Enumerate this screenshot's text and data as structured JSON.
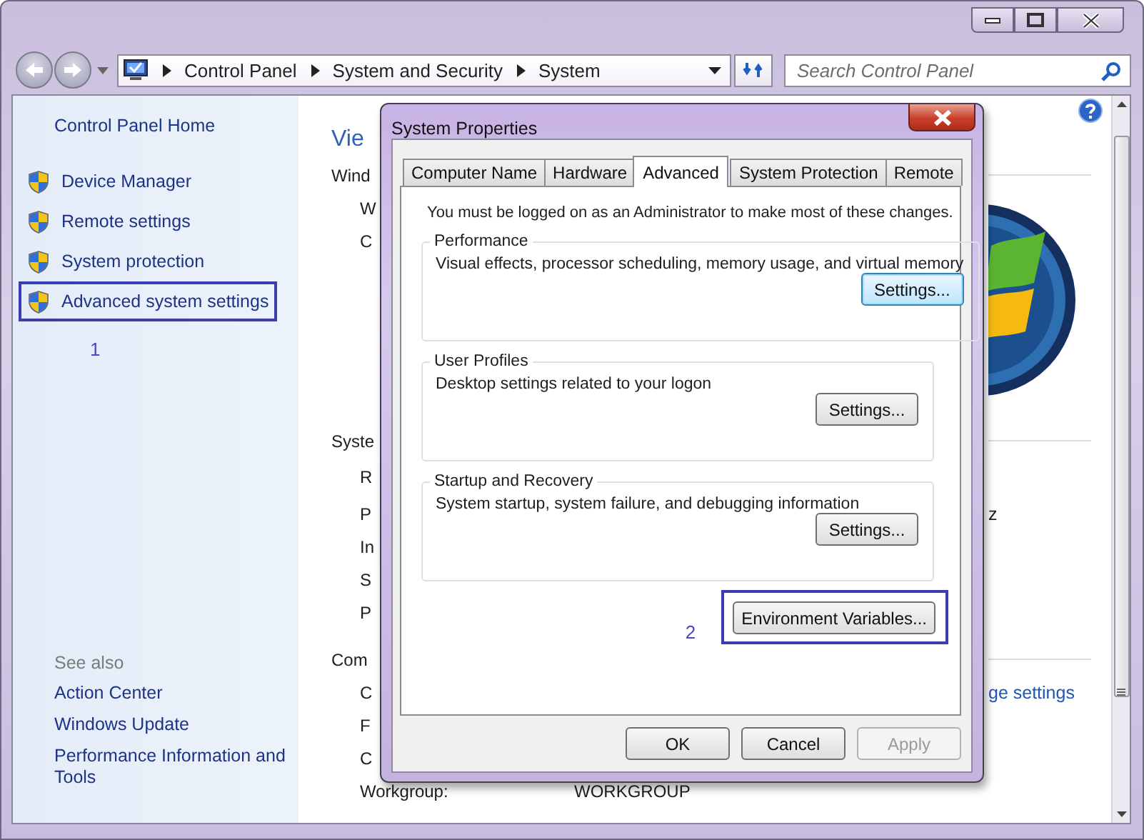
{
  "address_bar": {
    "crumbs": [
      "Control Panel",
      "System and Security",
      "System"
    ]
  },
  "search": {
    "placeholder": "Search Control Panel"
  },
  "sidebar": {
    "home": "Control Panel Home",
    "tasks": [
      {
        "label": "Device Manager",
        "highlighted": false
      },
      {
        "label": "Remote settings",
        "highlighted": false
      },
      {
        "label": "System protection",
        "highlighted": false
      },
      {
        "label": "Advanced system settings",
        "highlighted": true
      }
    ],
    "step_label": "1",
    "see_also": {
      "title": "See also",
      "links": [
        "Action Center",
        "Windows Update",
        "Performance Information and Tools"
      ]
    }
  },
  "content": {
    "title": "Vie",
    "sections": [
      {
        "heading": "Wind",
        "rows": [
          {
            "label": "W"
          },
          {
            "label": "C"
          }
        ]
      },
      {
        "heading": "Syste",
        "rows": [
          {
            "label": "R"
          },
          {
            "label": "P",
            "tail": {
              "text": "z",
              "kind": "text"
            }
          },
          {
            "label": "In"
          },
          {
            "label": "S"
          },
          {
            "label": "P"
          }
        ]
      },
      {
        "heading": "Com",
        "rows": [
          {
            "label": "C",
            "tail": {
              "text": "ge settings",
              "kind": "link"
            }
          },
          {
            "label": "F"
          },
          {
            "label": "C"
          },
          {
            "label": "Workgroup:",
            "value": "WORKGROUP"
          }
        ]
      }
    ]
  },
  "dialog": {
    "title": "System Properties",
    "tabs": [
      {
        "label": "Computer Name",
        "selected": false
      },
      {
        "label": "Hardware",
        "selected": false
      },
      {
        "label": "Advanced",
        "selected": true
      },
      {
        "label": "System Protection",
        "selected": false
      },
      {
        "label": "Remote",
        "selected": false
      }
    ],
    "notice": "You must be logged on as an Administrator to make most of these changes.",
    "groups": [
      {
        "legend": "Performance",
        "description": "Visual effects, processor scheduling, memory usage, and virtual memory",
        "button": {
          "label": "Settings...",
          "default": true
        }
      },
      {
        "legend": "User Profiles",
        "description": "Desktop settings related to your logon",
        "button": {
          "label": "Settings...",
          "default": false
        }
      },
      {
        "legend": "Startup and Recovery",
        "description": "System startup, system failure, and debugging information",
        "button": {
          "label": "Settings...",
          "default": false
        }
      }
    ],
    "step_label": "2",
    "env_button": {
      "label": "Environment Variables...",
      "highlighted": true
    },
    "buttons": [
      {
        "label": "OK",
        "disabled": false
      },
      {
        "label": "Cancel",
        "disabled": false
      },
      {
        "label": "Apply",
        "disabled": true
      }
    ]
  }
}
